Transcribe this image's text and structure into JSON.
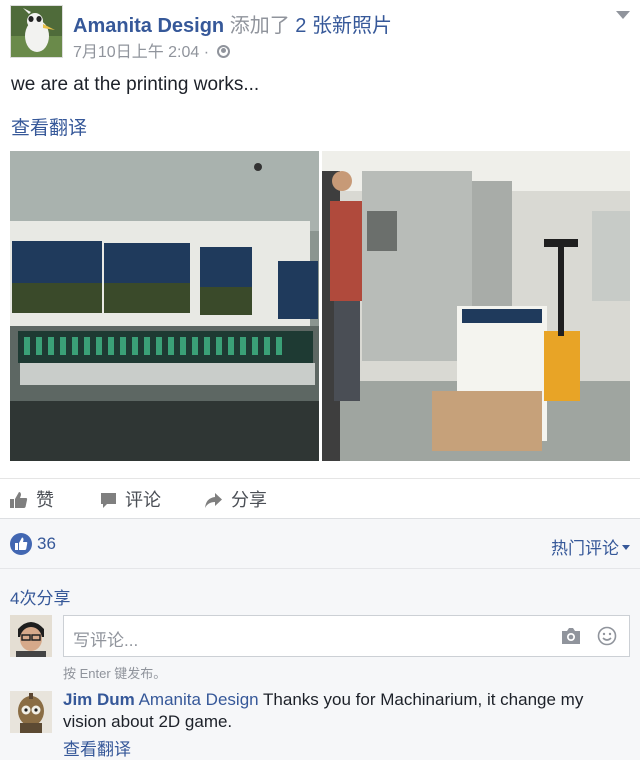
{
  "header": {
    "page_name": "Amanita Design",
    "action_prefix": "添加了",
    "action_count": "2",
    "action_suffix": "张新照片",
    "date": "7月10日上午",
    "time": "2:04",
    "dot": "·",
    "privacy_icon": "globe-icon",
    "options_icon": "chevron-down-icon"
  },
  "post": {
    "text": "we are at the printing works...",
    "see_translation": "查看翻译"
  },
  "photos": {
    "count": 2,
    "photo1_desc_icon": "printing-press-control-panel",
    "photo2_desc_icon": "printing-works-pallet"
  },
  "actions": {
    "like": "赞",
    "comment": "评论",
    "share": "分享"
  },
  "ufi": {
    "like_count": "36",
    "sort_label": "热门评论",
    "shares": "4次分享",
    "comment_placeholder": "写评论...",
    "enter_hint": "按 Enter 键发布。"
  },
  "comment": {
    "author": "Jim Dum",
    "tagged": "Amanita Design",
    "text": "Thanks you for Machinarium, it change my vision about 2D game.",
    "see_translation": "查看翻译"
  },
  "colors": {
    "link": "#365899",
    "secondary": "#90949c",
    "like_blue": "#4267b2",
    "ufi_bg": "#f6f7f9"
  }
}
